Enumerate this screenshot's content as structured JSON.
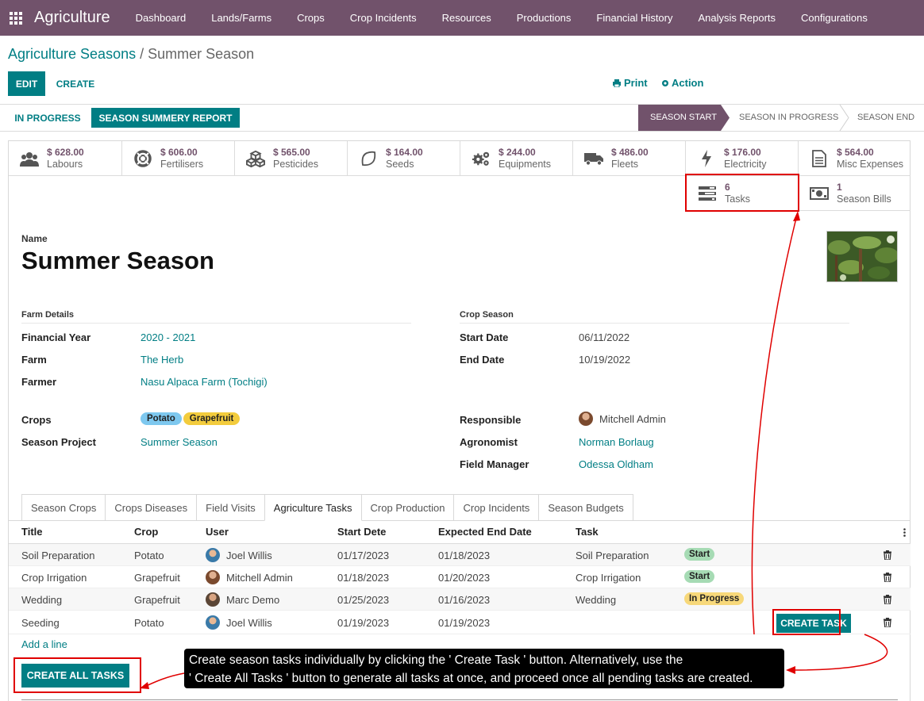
{
  "nav": {
    "app_title": "Agriculture",
    "menu": [
      "Dashboard",
      "Lands/Farms",
      "Crops",
      "Crop Incidents",
      "Resources",
      "Productions",
      "Financial History",
      "Analysis Reports",
      "Configurations"
    ]
  },
  "breadcrumb": {
    "parent": "Agriculture Seasons",
    "separator": " / ",
    "current": "Summer Season"
  },
  "control": {
    "edit": "EDIT",
    "create": "CREATE",
    "print": "Print",
    "action": "Action"
  },
  "status": {
    "in_progress": "IN PROGRESS",
    "report": "SEASON SUMMERY REPORT",
    "stages": [
      "SEASON START",
      "SEASON IN PROGRESS",
      "SEASON END"
    ],
    "active_stage": "SEASON START"
  },
  "smart_buttons": [
    {
      "value": "$ 628.00",
      "label": "Labours",
      "icon": "users-icon"
    },
    {
      "value": "$ 606.00",
      "label": "Fertilisers",
      "icon": "life-ring-icon"
    },
    {
      "value": "$ 565.00",
      "label": "Pesticides",
      "icon": "cubes-icon"
    },
    {
      "value": "$ 164.00",
      "label": "Seeds",
      "icon": "leaf-icon"
    },
    {
      "value": "$ 244.00",
      "label": "Equipments",
      "icon": "cogs-icon"
    },
    {
      "value": "$ 486.00",
      "label": "Fleets",
      "icon": "truck-icon"
    },
    {
      "value": "$ 176.00",
      "label": "Electricity",
      "icon": "bolt-icon"
    },
    {
      "value": "$ 564.00",
      "label": "Misc Expenses",
      "icon": "file-text-icon"
    },
    {
      "value": "6",
      "label": "Tasks",
      "icon": "tasks-icon"
    },
    {
      "value": "1",
      "label": "Season Bills",
      "icon": "money-icon"
    }
  ],
  "form": {
    "name_label": "Name",
    "name": "Summer Season",
    "farm_details_header": "Farm Details",
    "crop_season_header": "Crop Season",
    "financial_year_label": "Financial Year",
    "financial_year": "2020 - 2021",
    "farm_label": "Farm",
    "farm": "The Herb",
    "farmer_label": "Farmer",
    "farmer": "Nasu Alpaca Farm (Tochigi)",
    "start_date_label": "Start Date",
    "start_date": "06/11/2022",
    "end_date_label": "End Date",
    "end_date": "10/19/2022",
    "crops_label": "Crops",
    "crops": [
      {
        "name": "Potato",
        "color": "#7ec8ef"
      },
      {
        "name": "Grapefruit",
        "color": "#f3cc3d"
      }
    ],
    "season_project_label": "Season Project",
    "season_project": "Summer Season",
    "responsible_label": "Responsible",
    "responsible": "Mitchell Admin",
    "agronomist_label": "Agronomist",
    "agronomist": "Norman Borlaug",
    "field_manager_label": "Field Manager",
    "field_manager": "Odessa Oldham"
  },
  "tabs": [
    "Season Crops",
    "Crops Diseases",
    "Field Visits",
    "Agriculture Tasks",
    "Crop Production",
    "Crop Incidents",
    "Season Budgets"
  ],
  "active_tab": "Agriculture Tasks",
  "tasks_table": {
    "columns": [
      "Title",
      "Crop",
      "User",
      "Start Dete",
      "Expected End Date",
      "Task"
    ],
    "rows": [
      {
        "title": "Soil Preparation",
        "crop": "Potato",
        "user": "Joel Willis",
        "start": "01/17/2023",
        "end": "01/18/2023",
        "task": "Soil Preparation",
        "state": "Start"
      },
      {
        "title": "Crop Irrigation",
        "crop": "Grapefruit",
        "user": "Mitchell Admin",
        "start": "01/18/2023",
        "end": "01/20/2023",
        "task": "Crop Irrigation",
        "state": "Start"
      },
      {
        "title": "Wedding",
        "crop": "Grapefruit",
        "user": "Marc Demo",
        "start": "01/25/2023",
        "end": "01/16/2023",
        "task": "Wedding",
        "state": "In Progress"
      },
      {
        "title": "Seeding",
        "crop": "Potato",
        "user": "Joel Willis",
        "start": "01/19/2023",
        "end": "01/19/2023",
        "task": "",
        "state": ""
      }
    ],
    "create_task_button": "CREATE TASK",
    "add_line": "Add a line",
    "create_all_button": "CREATE ALL TASKS"
  },
  "annotation": {
    "line1": "Create season tasks individually by clicking the ' Create Task ' button. Alternatively, use the",
    "line2": "' Create All Tasks ' button to generate all tasks at once, and proceed once all pending tasks are created."
  },
  "colors": {
    "brand": "#71526b",
    "primary": "#017e84",
    "start_badge": "#a6dbb4",
    "progress_badge": "#f7d87a",
    "highlight": "#e00000"
  }
}
